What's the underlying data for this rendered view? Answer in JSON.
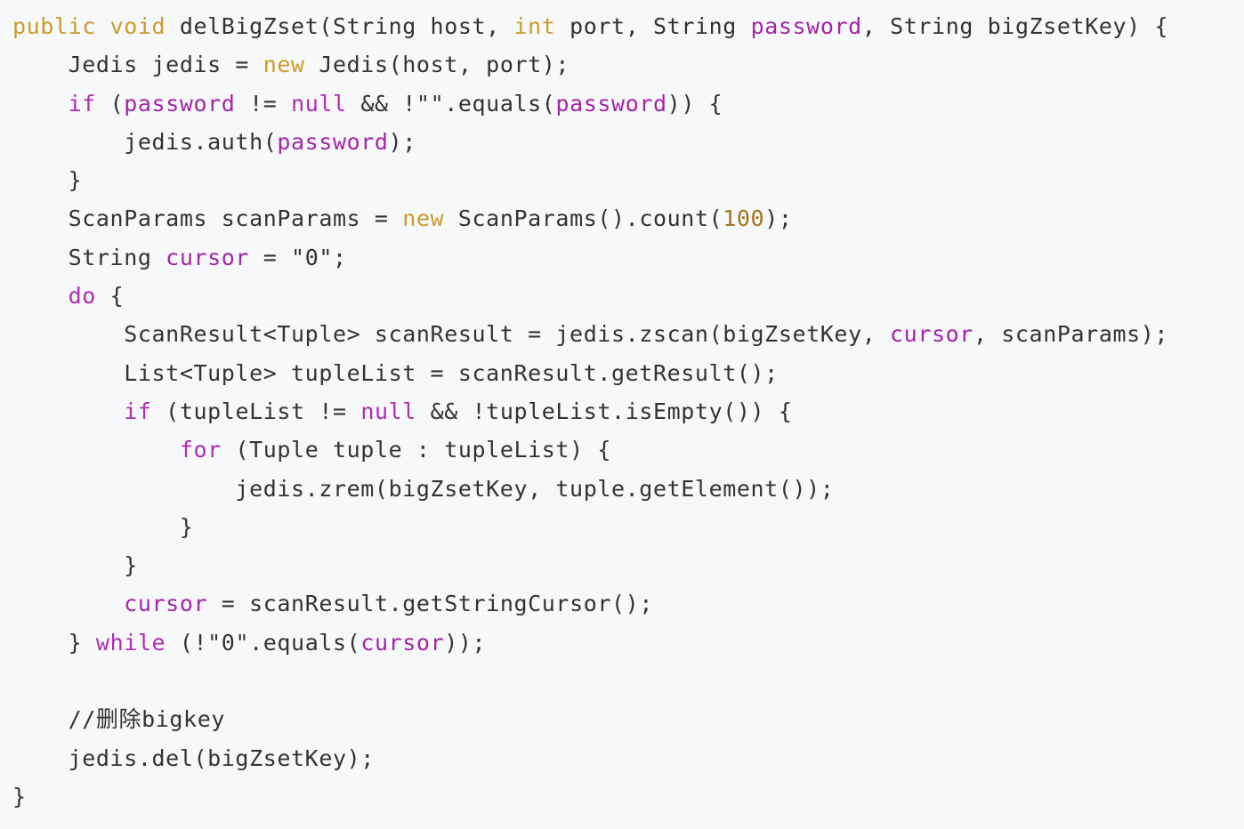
{
  "colors": {
    "background": "#f6f8fa",
    "plain_text": "#333333",
    "keyword_gold": "#ca9d28",
    "keyword_purple": "#b02db6",
    "variable_purple": "#a525a8",
    "number": "#a0761a"
  },
  "code": {
    "lines": [
      {
        "tokens": [
          {
            "t": "public",
            "k": "kw"
          },
          {
            "t": " ",
            "k": "plain"
          },
          {
            "t": "void",
            "k": "kw"
          },
          {
            "t": " delBigZset(String host, ",
            "k": "plain"
          },
          {
            "t": "int",
            "k": "kw"
          },
          {
            "t": " port, String ",
            "k": "plain"
          },
          {
            "t": "password",
            "k": "var"
          },
          {
            "t": ", String bigZsetKey) {",
            "k": "plain"
          }
        ]
      },
      {
        "tokens": [
          {
            "t": "    Jedis jedis = ",
            "k": "plain"
          },
          {
            "t": "new",
            "k": "kw"
          },
          {
            "t": " Jedis(host, port);",
            "k": "plain"
          }
        ]
      },
      {
        "tokens": [
          {
            "t": "    ",
            "k": "plain"
          },
          {
            "t": "if",
            "k": "kw2"
          },
          {
            "t": " (",
            "k": "plain"
          },
          {
            "t": "password",
            "k": "var"
          },
          {
            "t": " != ",
            "k": "plain"
          },
          {
            "t": "null",
            "k": "kw2"
          },
          {
            "t": " && !\"\".equals(",
            "k": "plain"
          },
          {
            "t": "password",
            "k": "var"
          },
          {
            "t": ")) {",
            "k": "plain"
          }
        ]
      },
      {
        "tokens": [
          {
            "t": "        jedis.auth(",
            "k": "plain"
          },
          {
            "t": "password",
            "k": "var"
          },
          {
            "t": ");",
            "k": "plain"
          }
        ]
      },
      {
        "tokens": [
          {
            "t": "    }",
            "k": "plain"
          }
        ]
      },
      {
        "tokens": [
          {
            "t": "    ScanParams scanParams = ",
            "k": "plain"
          },
          {
            "t": "new",
            "k": "kw"
          },
          {
            "t": " ScanParams().count(",
            "k": "plain"
          },
          {
            "t": "100",
            "k": "num"
          },
          {
            "t": ");",
            "k": "plain"
          }
        ]
      },
      {
        "tokens": [
          {
            "t": "    String ",
            "k": "plain"
          },
          {
            "t": "cursor",
            "k": "var"
          },
          {
            "t": " = \"0\";",
            "k": "plain"
          }
        ]
      },
      {
        "tokens": [
          {
            "t": "    ",
            "k": "plain"
          },
          {
            "t": "do",
            "k": "kw2"
          },
          {
            "t": " {",
            "k": "plain"
          }
        ]
      },
      {
        "tokens": [
          {
            "t": "        ScanResult<Tuple> scanResult = jedis.zscan(bigZsetKey, ",
            "k": "plain"
          },
          {
            "t": "cursor",
            "k": "var"
          },
          {
            "t": ", scanParams);",
            "k": "plain"
          }
        ]
      },
      {
        "tokens": [
          {
            "t": "        List<Tuple> tupleList = scanResult.getResult();",
            "k": "plain"
          }
        ]
      },
      {
        "tokens": [
          {
            "t": "        ",
            "k": "plain"
          },
          {
            "t": "if",
            "k": "kw2"
          },
          {
            "t": " (tupleList != ",
            "k": "plain"
          },
          {
            "t": "null",
            "k": "kw2"
          },
          {
            "t": " && !tupleList.isEmpty()) {",
            "k": "plain"
          }
        ]
      },
      {
        "tokens": [
          {
            "t": "            ",
            "k": "plain"
          },
          {
            "t": "for",
            "k": "kw2"
          },
          {
            "t": " (Tuple tuple : tupleList) {",
            "k": "plain"
          }
        ]
      },
      {
        "tokens": [
          {
            "t": "                jedis.zrem(bigZsetKey, tuple.getElement());",
            "k": "plain"
          }
        ]
      },
      {
        "tokens": [
          {
            "t": "            }",
            "k": "plain"
          }
        ]
      },
      {
        "tokens": [
          {
            "t": "        }",
            "k": "plain"
          }
        ]
      },
      {
        "tokens": [
          {
            "t": "        ",
            "k": "plain"
          },
          {
            "t": "cursor",
            "k": "var"
          },
          {
            "t": " = scanResult.getStringCursor();",
            "k": "plain"
          }
        ]
      },
      {
        "tokens": [
          {
            "t": "    } ",
            "k": "plain"
          },
          {
            "t": "while",
            "k": "kw2"
          },
          {
            "t": " (!\"0\".equals(",
            "k": "plain"
          },
          {
            "t": "cursor",
            "k": "var"
          },
          {
            "t": "));",
            "k": "plain"
          }
        ]
      },
      {
        "tokens": [
          {
            "t": "",
            "k": "plain"
          }
        ]
      },
      {
        "tokens": [
          {
            "t": "    //删除bigkey",
            "k": "comment"
          }
        ]
      },
      {
        "tokens": [
          {
            "t": "    jedis.del(bigZsetKey);",
            "k": "plain"
          }
        ]
      },
      {
        "tokens": [
          {
            "t": "}",
            "k": "plain"
          }
        ]
      }
    ]
  }
}
